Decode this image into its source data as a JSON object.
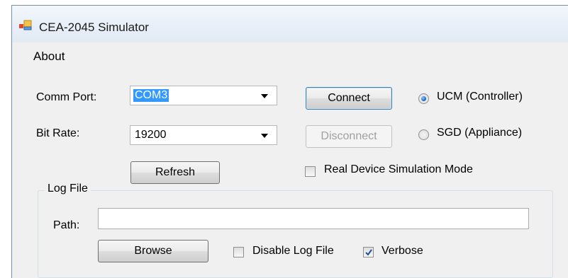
{
  "window": {
    "title": "CEA-2045 Simulator"
  },
  "menu": {
    "items": [
      "About"
    ]
  },
  "connection": {
    "comm_port_label": "Comm Port:",
    "comm_port_value": "COM3",
    "bit_rate_label": "Bit Rate:",
    "bit_rate_value": "19200",
    "refresh_label": "Refresh",
    "connect_label": "Connect",
    "disconnect_label": "Disconnect"
  },
  "mode": {
    "options": [
      {
        "label": "UCM (Controller)",
        "selected": true
      },
      {
        "label": "SGD (Appliance)",
        "selected": false
      }
    ],
    "real_device_label": "Real Device Simulation Mode",
    "real_device_checked": false
  },
  "log_file": {
    "group_title": "Log File",
    "path_label": "Path:",
    "path_value": "",
    "browse_label": "Browse",
    "disable_label": "Disable Log File",
    "disable_checked": false,
    "verbose_label": "Verbose",
    "verbose_checked": true
  },
  "colors": {
    "accent": "#3399ff",
    "window_bg": "#f0f0f0"
  },
  "icons": {
    "app": "app-window-icon",
    "dropdown": "chevron-down-icon",
    "check": "checkmark-icon"
  }
}
